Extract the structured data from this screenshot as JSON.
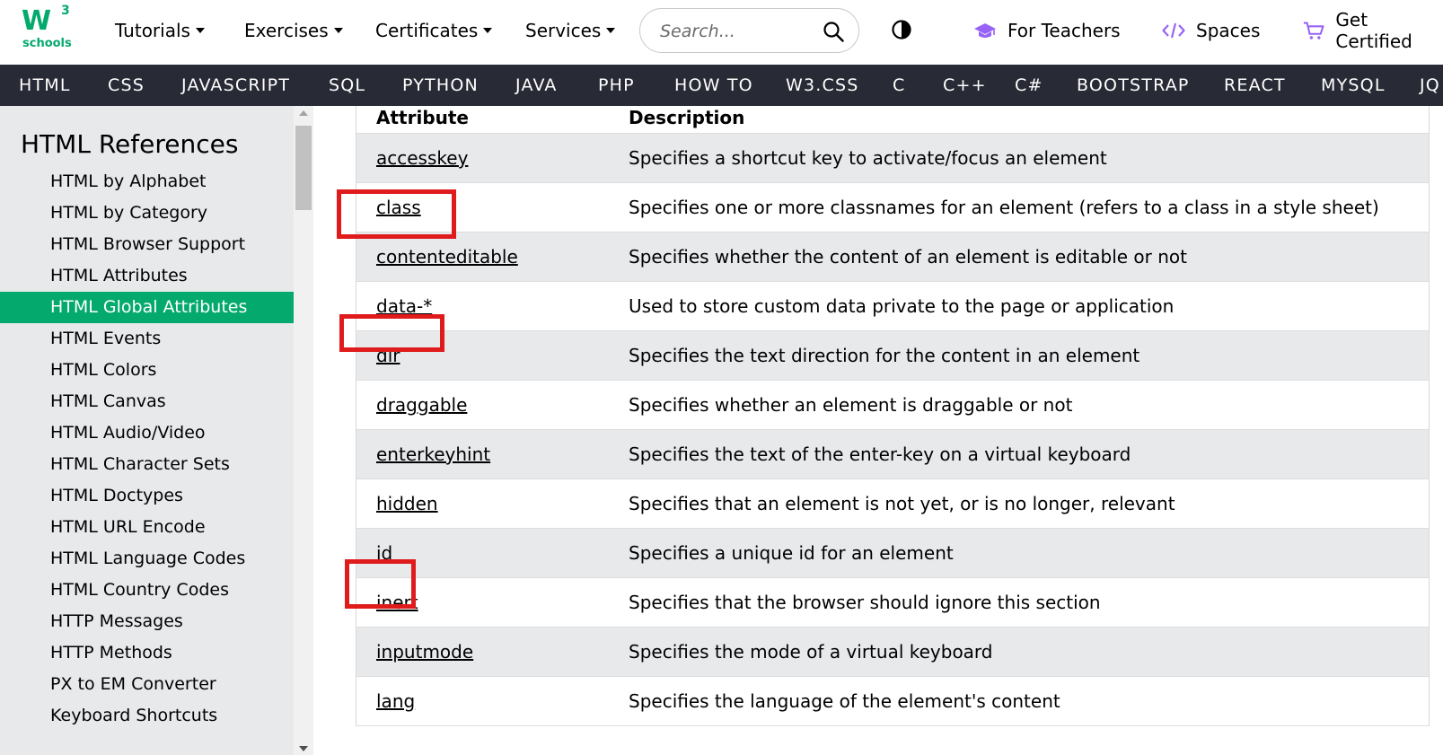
{
  "logo": {
    "main": "W",
    "sup": "3",
    "sub": "schools"
  },
  "topnav": {
    "menus": [
      "Tutorials",
      "Exercises",
      "Certificates",
      "Services"
    ],
    "search_placeholder": "Search...",
    "links": {
      "teachers": "For Teachers",
      "spaces": "Spaces",
      "certified": "Get Certified"
    },
    "icons": {
      "search": "search-icon",
      "contrast": "contrast-icon",
      "teachers": "graduation-cap-icon",
      "spaces": "code-icon",
      "certified": "cart-icon"
    }
  },
  "navbar": [
    "HTML",
    "CSS",
    "JAVASCRIPT",
    "SQL",
    "PYTHON",
    "JAVA",
    "PHP",
    "HOW TO",
    "W3.CSS",
    "C",
    "C++",
    "C#",
    "BOOTSTRAP",
    "REACT",
    "MYSQL",
    "JQ"
  ],
  "sidebar": {
    "title": "HTML References",
    "items": [
      "HTML by Alphabet",
      "HTML by Category",
      "HTML Browser Support",
      "HTML Attributes",
      "HTML Global Attributes",
      "HTML Events",
      "HTML Colors",
      "HTML Canvas",
      "HTML Audio/Video",
      "HTML Character Sets",
      "HTML Doctypes",
      "HTML URL Encode",
      "HTML Language Codes",
      "HTML Country Codes",
      "HTTP Messages",
      "HTTP Methods",
      "PX to EM Converter",
      "Keyboard Shortcuts"
    ],
    "active_item": "HTML Global Attributes"
  },
  "table": {
    "headers": [
      "Attribute",
      "Description"
    ],
    "rows": [
      {
        "attr": "accesskey",
        "desc": "Specifies a shortcut key to activate/focus an element"
      },
      {
        "attr": "class",
        "desc": "Specifies one or more classnames for an element (refers to a class in a style sheet)"
      },
      {
        "attr": "contenteditable",
        "desc": "Specifies whether the content of an element is editable or not"
      },
      {
        "attr": "data-*",
        "desc": "Used to store custom data private to the page or application"
      },
      {
        "attr": "dir",
        "desc": "Specifies the text direction for the content in an element"
      },
      {
        "attr": "draggable",
        "desc": "Specifies whether an element is draggable or not"
      },
      {
        "attr": "enterkeyhint",
        "desc": "Specifies the text of the enter-key on a virtual keyboard"
      },
      {
        "attr": "hidden",
        "desc": "Specifies that an element is not yet, or is no longer, relevant"
      },
      {
        "attr": "id",
        "desc": "Specifies a unique id for an element"
      },
      {
        "attr": "inert",
        "desc": "Specifies that the browser should ignore this section"
      },
      {
        "attr": "inputmode",
        "desc": "Specifies the mode of a virtual keyboard"
      },
      {
        "attr": "lang",
        "desc": "Specifies the language of the element's content"
      }
    ]
  },
  "highlighted_attributes": [
    "class",
    "data-*",
    "id"
  ],
  "colors": {
    "brand_green": "#04AA6D",
    "nav_dark": "#282A35",
    "sidebar_bg": "#E7E9EB",
    "highlight_red": "#e01b1b",
    "accent_purple": "#9763f6"
  }
}
